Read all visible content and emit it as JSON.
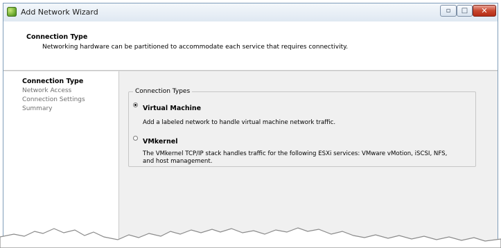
{
  "window": {
    "title": "Add Network Wizard",
    "app_icon": "vsphere-client-icon"
  },
  "header": {
    "title": "Connection Type",
    "subtitle": "Networking hardware can be partitioned to accommodate each service that requires connectivity."
  },
  "sidebar": {
    "steps": [
      {
        "label": "Connection Type",
        "active": true
      },
      {
        "label": "Network Access",
        "active": false
      },
      {
        "label": "Connection Settings",
        "active": false
      },
      {
        "label": "Summary",
        "active": false
      }
    ]
  },
  "connection_types": {
    "legend": "Connection Types",
    "options": [
      {
        "label": "Virtual Machine",
        "selected": true,
        "description": "Add a labeled network to handle virtual machine network traffic."
      },
      {
        "label": "VMkernel",
        "selected": false,
        "description_line1": "The VMkernel TCP/IP stack handles traffic for the following ESXi services: VMware vMotion, iSCSI, NFS,",
        "description_line2": "and host management."
      }
    ]
  }
}
